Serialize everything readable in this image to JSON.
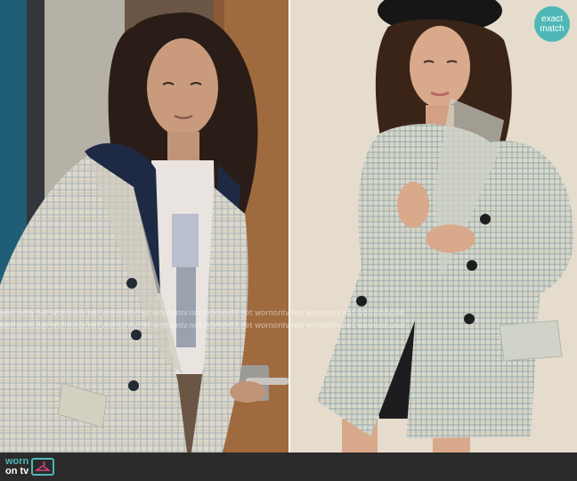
{
  "badge": {
    "line1": "exact",
    "line2": "match"
  },
  "logo": {
    "worn": "worn",
    "ontv": "on tv",
    "icon": "tv-hanger-icon"
  },
  "watermark": {
    "text": "wornontv.net wornontv.net wornontv.net wornontv.net wornontv.net wornontv.net wornontv.net wornontv.net"
  },
  "colors": {
    "brand": "#4fb8b6",
    "footer": "#2b2b2b",
    "blazer": "#d9d7ca",
    "plaid_line": "#9aa6ad",
    "navy": "#1e2a44"
  }
}
